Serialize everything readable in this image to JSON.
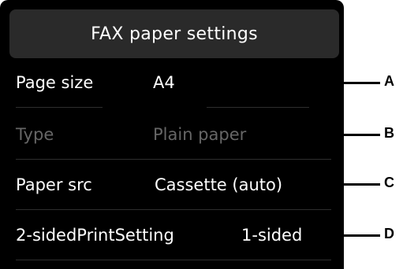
{
  "title": "FAX paper settings",
  "rows": [
    {
      "label": "Page size",
      "value": "A4",
      "state": "enabled",
      "callout": "A"
    },
    {
      "label": "Type",
      "value": "Plain paper",
      "state": "disabled",
      "callout": "B"
    },
    {
      "label": "Paper src",
      "value": "Cassette (auto)",
      "state": "enabled",
      "callout": "C"
    },
    {
      "label": "2-sidedPrintSetting",
      "value": "1-sided",
      "state": "enabled",
      "callout": "D"
    }
  ],
  "colors": {
    "screen": "#000000",
    "title_bar": "#2a2a2a",
    "text_enabled": "#ffffff",
    "text_disabled": "#666666"
  }
}
